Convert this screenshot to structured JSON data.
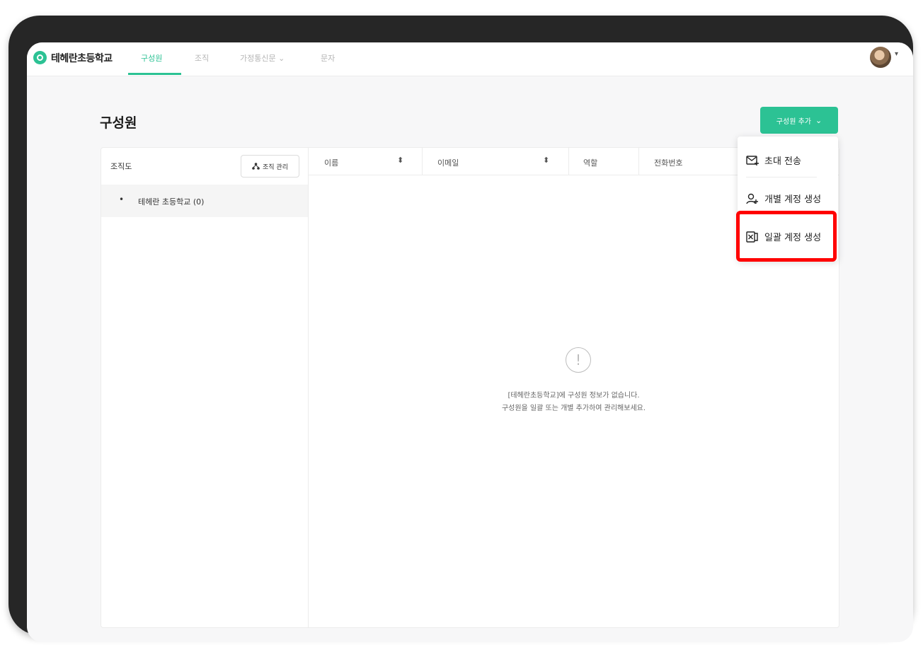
{
  "nav": {
    "school_name": "테헤란초등학교",
    "tabs": [
      "구성원",
      "조직",
      "가정통신문 ⌄",
      "문자"
    ],
    "avatar_caret": "▾"
  },
  "page": {
    "title": "구성원",
    "add_button_label": "구성원 추가",
    "add_button_caret": "⌄"
  },
  "org": {
    "title": "조직도",
    "manage_label": "조직 관리",
    "tree": [
      {
        "label": "테헤란 초등학교 (0)"
      }
    ]
  },
  "table": {
    "columns": [
      "이름",
      "이메일",
      "역할",
      "전화번호"
    ],
    "sort_glyph": "⬍"
  },
  "empty": {
    "line1": "[테헤란초등학교]에 구성원 정보가 없습니다.",
    "line2": "구성원을 일괄 또는 개별 추가하여 관리해보세요."
  },
  "dropdown": {
    "items": [
      {
        "label": "초대 전송",
        "icon": "mail-send-icon"
      },
      {
        "label": "개별 계정 생성",
        "icon": "person-add-icon"
      },
      {
        "label": "일괄 계정 생성",
        "icon": "excel-file-icon"
      }
    ]
  },
  "colors": {
    "accent": "#2cc294",
    "highlight": "#ff0000"
  }
}
